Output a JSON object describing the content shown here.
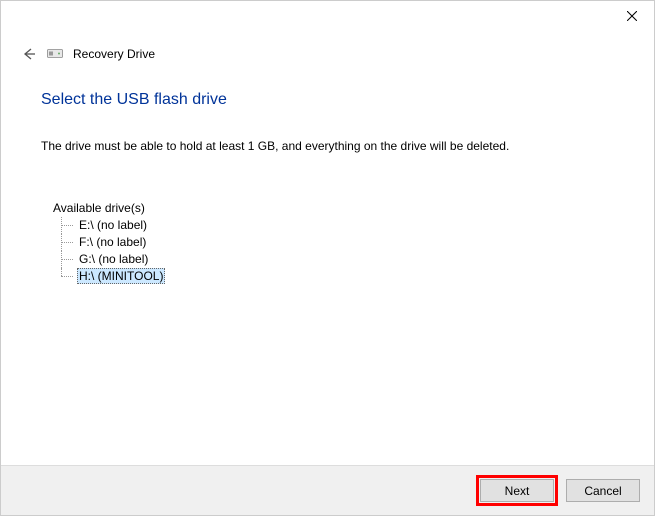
{
  "titlebar": {
    "close_label": "Close"
  },
  "header": {
    "wizard_title": "Recovery Drive"
  },
  "page": {
    "heading": "Select the USB flash drive",
    "instruction": "The drive must be able to hold at least 1 GB, and everything on the drive will be deleted."
  },
  "drives": {
    "label": "Available drive(s)",
    "items": [
      {
        "text": "E:\\ (no label)",
        "selected": false
      },
      {
        "text": "F:\\ (no label)",
        "selected": false
      },
      {
        "text": "G:\\ (no label)",
        "selected": false
      },
      {
        "text": "H:\\ (MINITOOL)",
        "selected": true
      }
    ]
  },
  "footer": {
    "next_label": "Next",
    "cancel_label": "Cancel"
  }
}
